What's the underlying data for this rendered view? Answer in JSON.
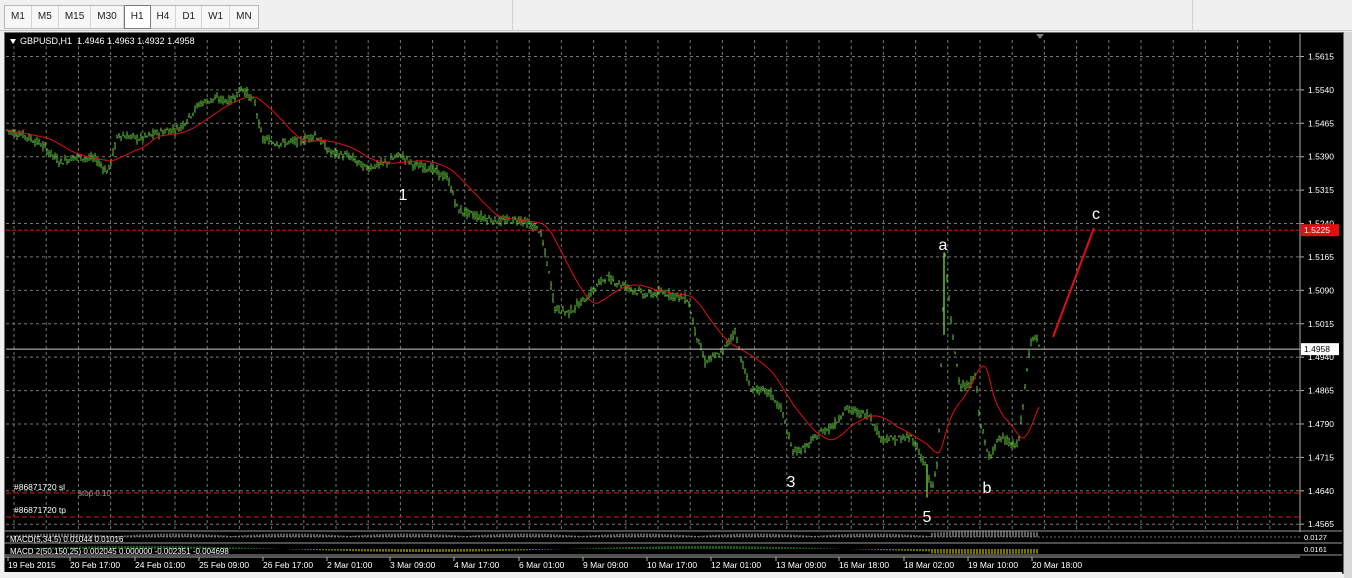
{
  "timeframes": [
    "M1",
    "M5",
    "M15",
    "M30",
    "H1",
    "H4",
    "D1",
    "W1",
    "MN"
  ],
  "active_timeframe": "H1",
  "chart_header": {
    "symbol": "GBPUSD,H1",
    "ohlc": "1.4946 1.4963 1.4932 1.4958"
  },
  "price_axis": {
    "ticks": [
      "1.5615",
      "1.5540",
      "1.5465",
      "1.5390",
      "1.5315",
      "1.5240",
      "1.5165",
      "1.5090",
      "1.5015",
      "1.4940",
      "1.4865",
      "1.4790",
      "1.4715",
      "1.4640",
      "1.4565"
    ],
    "current_price": "1.4958",
    "target_price": "1.5225"
  },
  "time_axis": {
    "labels": [
      "19 Feb 2015",
      "20 Feb 17:00",
      "24 Feb 01:00",
      "25 Feb 09:00",
      "26 Feb 17:00",
      "2 Mar 01:00",
      "3 Mar 09:00",
      "4 Mar 17:00",
      "6 Mar 01:00",
      "9 Mar 09:00",
      "10 Mar 17:00",
      "12 Mar 01:00",
      "13 Mar 09:00",
      "16 Mar 18:00",
      "18 Mar 02:00",
      "19 Mar 10:00",
      "20 Mar 18:00"
    ]
  },
  "orders": {
    "sl_label": "#86871720 sl",
    "sl_sub": "stop 0.10",
    "tp_label": "#86871720 tp"
  },
  "wave_labels": [
    "1",
    "3",
    "5",
    "a",
    "b",
    "c"
  ],
  "indicators": {
    "macd1": "MACD(5,34,5) 0.01044 0.01016",
    "macd1_scale": "0.0127",
    "macd2": "MACD 2(50,150,25) 0.002045 0.000000 -0.002351 -0.004698",
    "macd2_scale": "0.0161"
  },
  "colors": {
    "background": "#000000",
    "candles": "#5fbf3a",
    "moving_average": "#e01010",
    "grid": "#6e7d6e",
    "target_line": "#e01010",
    "projection": "#e01010"
  }
}
